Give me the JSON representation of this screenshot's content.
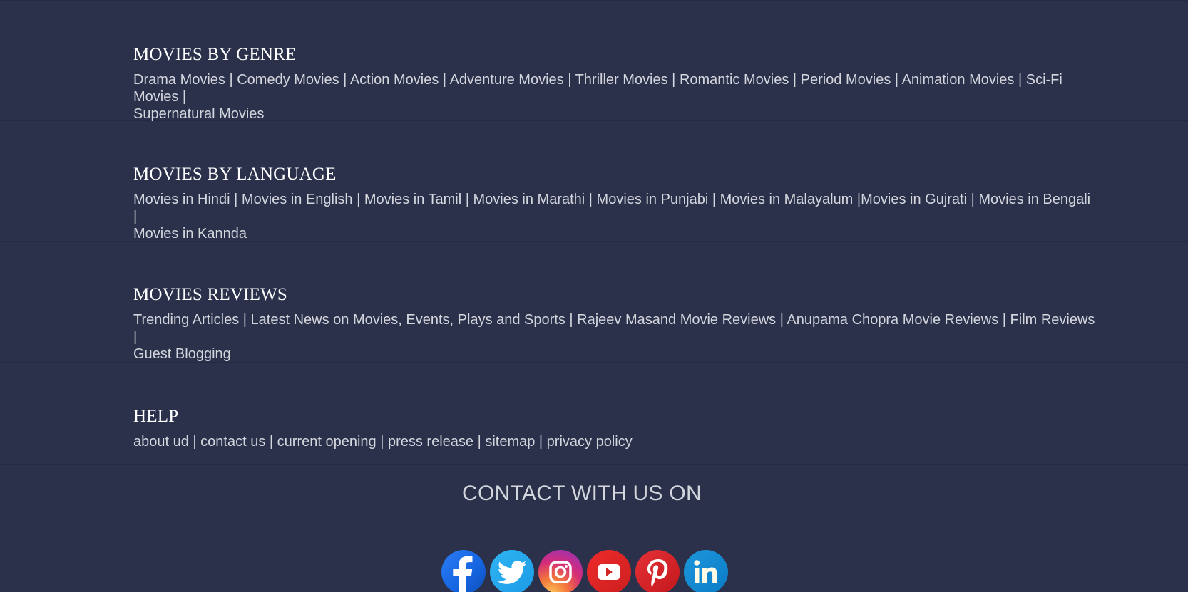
{
  "sections": {
    "genre": {
      "title": "MOVIES BY GENRE",
      "links": [
        "Drama Movies",
        "Comedy Movies",
        "Action Movies",
        "Adventure Movies",
        "Thriller Movies",
        "Romantic Movies",
        "Period Movies",
        "Animation Movies",
        "Sci-Fi Movies",
        "Supernatural Movies"
      ]
    },
    "language": {
      "title": "MOVIES BY LANGUAGE",
      "links": [
        "Movies in Hindi",
        "Movies in English",
        "Movies in Tamil",
        "Movies in Marathi",
        "Movies in Punjabi",
        "Movies in Malayalum",
        "Movies in Gujrati",
        "Movies in Bengali",
        "Movies in Kannda"
      ]
    },
    "reviews": {
      "title": "MOVIES REVIEWS",
      "links": [
        "Trending Articles",
        "Latest News on Movies, Events, Plays and Sports",
        "Rajeev Masand Movie Reviews",
        "Anupama Chopra Movie Reviews",
        "Film Reviews",
        "Guest Blogging"
      ]
    },
    "help": {
      "title": "HELP",
      "links": [
        "about ud",
        "contact us",
        "current opening",
        "press release",
        "sitemap",
        "privacy policy"
      ]
    }
  },
  "contact": {
    "title": "CONTACT WITH US ON",
    "social": [
      {
        "name": "facebook",
        "icon": "facebook-icon"
      },
      {
        "name": "twitter",
        "icon": "twitter-icon"
      },
      {
        "name": "instagram",
        "icon": "instagram-icon"
      },
      {
        "name": "youtube",
        "icon": "youtube-icon"
      },
      {
        "name": "pinterest",
        "icon": "pinterest-icon"
      },
      {
        "name": "linkedin",
        "icon": "linkedin-icon"
      }
    ]
  },
  "colors": {
    "background": "#2b314b",
    "divider": "#252a40",
    "heading": "#ffffff",
    "link": "#d4d6dd"
  }
}
